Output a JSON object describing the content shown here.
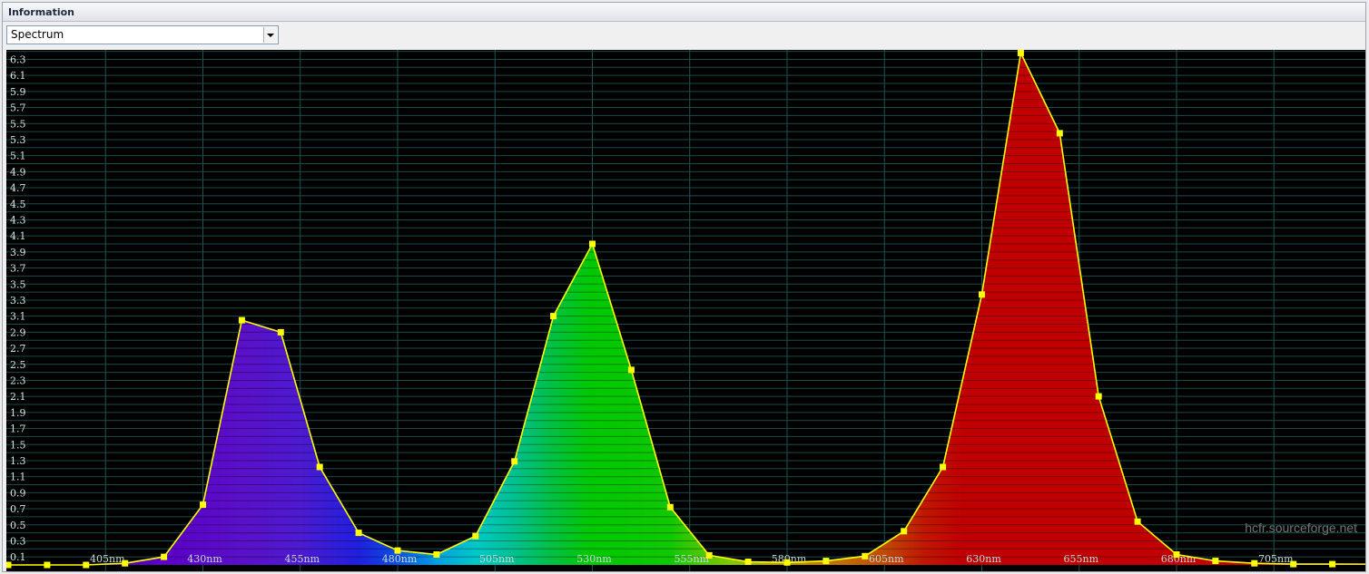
{
  "panel": {
    "title": "Information",
    "view_select": {
      "value": "Spectrum"
    }
  },
  "chart_data": {
    "type": "area",
    "xlabel": "",
    "ylabel": "",
    "x_unit": "nm",
    "xlim": [
      380,
      730
    ],
    "ylim": [
      0,
      6.4
    ],
    "ytick_labels": [
      "0.1",
      "0.3",
      "0.5",
      "0.7",
      "0.9",
      "1.1",
      "1.3",
      "1.5",
      "1.7",
      "1.9",
      "2.1",
      "2.3",
      "2.5",
      "2.7",
      "2.9",
      "3.1",
      "3.3",
      "3.5",
      "3.7",
      "3.9",
      "4.1",
      "4.3",
      "4.5",
      "4.7",
      "4.9",
      "5.1",
      "5.3",
      "5.5",
      "5.7",
      "5.9",
      "6.1",
      "6.3"
    ],
    "xtick_labels": [
      "405nm",
      "430nm",
      "455nm",
      "480nm",
      "505nm",
      "530nm",
      "555nm",
      "580nm",
      "605nm",
      "630nm",
      "655nm",
      "680nm",
      "705nm"
    ],
    "grid": true,
    "fill": "wavelength spectrum colors",
    "line_color": "#ffff00",
    "marker_color": "#ffff00",
    "series": [
      {
        "x": [
          380,
          390,
          400,
          410,
          420,
          430,
          440,
          450,
          460,
          470,
          480,
          490,
          500,
          510,
          520,
          530,
          540,
          550,
          560,
          570,
          580,
          590,
          600,
          610,
          620,
          630,
          640,
          650,
          660,
          670,
          680,
          690,
          700,
          710,
          720
        ],
        "values": [
          0.0,
          0.0,
          0.0,
          0.02,
          0.1,
          0.75,
          3.05,
          2.9,
          1.22,
          0.4,
          0.18,
          0.13,
          0.36,
          1.29,
          3.1,
          4.0,
          2.43,
          0.72,
          0.12,
          0.04,
          0.03,
          0.05,
          0.11,
          0.42,
          1.22,
          3.37,
          6.38,
          5.38,
          2.1,
          0.54,
          0.13,
          0.05,
          0.02,
          0.01,
          0.01
        ]
      }
    ]
  },
  "watermark": "hcfr.sourceforge.net"
}
